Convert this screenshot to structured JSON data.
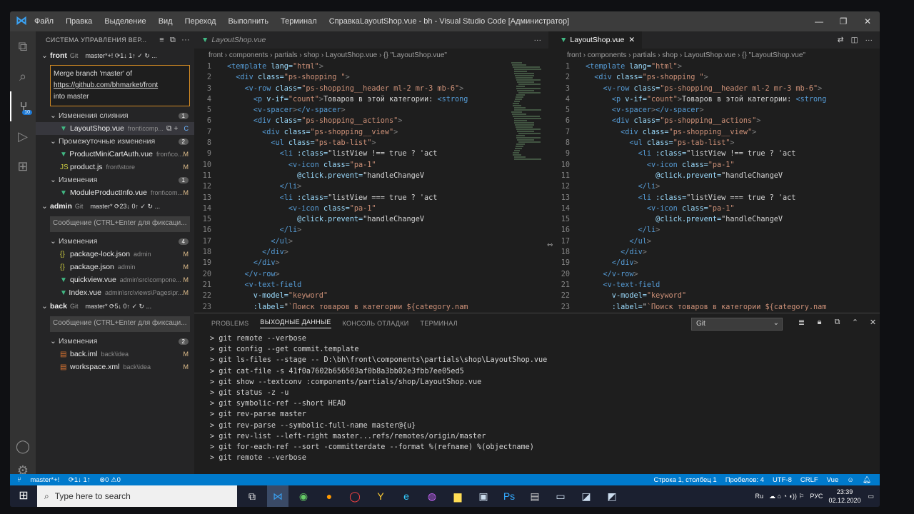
{
  "titlebar": {
    "menu": [
      "Файл",
      "Правка",
      "Выделение",
      "Вид",
      "Переход",
      "Выполнить",
      "Терминал",
      "Справка"
    ],
    "title": "LayoutShop.vue - bh - Visual Studio Code [Администратор]"
  },
  "sidebar": {
    "header": "СИСТЕМА УПРАВЛЕНИЯ ВЕР...",
    "repos": [
      {
        "name": "front",
        "git": "Git",
        "status": "master*+! ⟳1↓ 1↑ ✓ ↻ ...",
        "message_lines": [
          "Merge branch 'master' of",
          "https://github.com/bhmarket/front",
          "into master"
        ],
        "groups": [
          {
            "label": "Изменения слияния",
            "count": "1",
            "files": [
              {
                "name": "LayoutShop.vue",
                "path": "front\\comp...",
                "status": "C",
                "icon": "vue"
              }
            ]
          },
          {
            "label": "Промежуточные изменения",
            "count": "2",
            "files": [
              {
                "name": "ProductMiniCartAuth.vue",
                "path": "front\\co...",
                "status": "M",
                "icon": "vue"
              },
              {
                "name": "product.js",
                "path": "front\\store",
                "status": "M",
                "icon": "js"
              }
            ]
          },
          {
            "label": "Изменения",
            "count": "1",
            "files": [
              {
                "name": "ModuleProductInfo.vue",
                "path": "front\\com...",
                "status": "M",
                "icon": "vue"
              }
            ]
          }
        ]
      },
      {
        "name": "admin",
        "git": "Git",
        "status": "master* ⟳23↓ 0↑ ✓ ↻ ...",
        "placeholder": "Сообщение (CTRL+Enter для фиксаци...",
        "groups": [
          {
            "label": "Изменения",
            "count": "4",
            "files": [
              {
                "name": "package-lock.json",
                "path": "admin",
                "status": "M",
                "icon": "json"
              },
              {
                "name": "package.json",
                "path": "admin",
                "status": "M",
                "icon": "json"
              },
              {
                "name": "quickview.vue",
                "path": "admin\\src\\compone...",
                "status": "M",
                "icon": "vue"
              },
              {
                "name": "Index.vue",
                "path": "admin\\src\\views\\Pages\\pr...",
                "status": "M",
                "icon": "vue"
              }
            ]
          }
        ]
      },
      {
        "name": "back",
        "git": "Git",
        "status": "master* ⟳5↓ 0↑ ✓ ↻ ...",
        "placeholder": "Сообщение (CTRL+Enter для фиксаци...",
        "groups": [
          {
            "label": "Изменения",
            "count": "2",
            "files": [
              {
                "name": "back.iml",
                "path": "back\\idea",
                "status": "M",
                "icon": "xml"
              },
              {
                "name": "workspace.xml",
                "path": "back\\idea",
                "status": "M",
                "icon": "xml"
              }
            ]
          }
        ]
      }
    ]
  },
  "editor1": {
    "tab": "LayoutShop.vue",
    "breadcrumb": "front › components › partials › shop › LayoutShop.vue › {} \"LayoutShop.vue\""
  },
  "editor2": {
    "tab": "LayoutShop.vue",
    "breadcrumb": "front › components › partials › shop › LayoutShop.vue › {} \"LayoutShop.vue\""
  },
  "code": [
    "<template lang=\"html\">",
    "  <div class=\"ps-shopping \">",
    "    <v-row class=\"ps-shopping__header ml-2 mr-3 mb-6\">",
    "      <p v-if=\"count\">Товаров в этой категории: <strong",
    "      <v-spacer></v-spacer>",
    "      <div class=\"ps-shopping__actions\">",
    "        <div class=\"ps-shopping__view\">",
    "          <ul class=\"ps-tab-list\">",
    "            <li :class=\"listView !== true ? 'act",
    "              <v-icon class=\"pa-1\"",
    "                @click.prevent=\"handleChangeV",
    "            </li>",
    "            <li :class=\"listView === true ? 'act",
    "              <v-icon class=\"pa-1\"",
    "                @click.prevent=\"handleChangeV",
    "            </li>",
    "          </ul>",
    "        </div>",
    "      </div>",
    "    </v-row>",
    "    <v-text-field",
    "      v-model=\"keyword\"",
    "      :label=\"`Поиск товаров в категории ${category.nam"
  ],
  "panel": {
    "tabs": [
      "PROBLEMS",
      "ВЫХОДНЫЕ ДАННЫЕ",
      "КОНСОЛЬ ОТЛАДКИ",
      "ТЕРМИНАЛ"
    ],
    "active_tab": "ВЫХОДНЫЕ ДАННЫЕ",
    "channel": "Git",
    "output": [
      "> git remote --verbose",
      "> git config --get commit.template",
      "> git ls-files --stage -- D:\\bh\\front\\components\\partials\\shop\\LayoutShop.vue",
      "> git cat-file -s 41f0a7602b656503af0b8a3bb02e3fbb7ee05ed5",
      "> git show --textconv :components/partials/shop/LayoutShop.vue",
      "> git status -z -u",
      "> git symbolic-ref --short HEAD",
      "> git rev-parse master",
      "> git rev-parse --symbolic-full-name master@{u}",
      "> git rev-list --left-right master...refs/remotes/origin/master",
      "> git for-each-ref --sort -committerdate --format %(refname) %(objectname)",
      "> git remote --verbose"
    ]
  },
  "statusbar": {
    "branch": "master*+!",
    "sync": "⟳1↓ 1↑",
    "problems": "⊗0 ⚠0",
    "position": "Строка 1, столбец 1",
    "spaces": "Пробелов: 4",
    "encoding": "UTF-8",
    "eol": "CRLF",
    "language": "Vue"
  },
  "taskbar": {
    "search_placeholder": "Type here to search",
    "lang": "РУС",
    "keyboard": "Ru",
    "time": "23:39",
    "date": "02.12.2020"
  },
  "colors": {
    "accent": "#007acc",
    "vue": "#41b883",
    "modified": "#e2c08d"
  }
}
